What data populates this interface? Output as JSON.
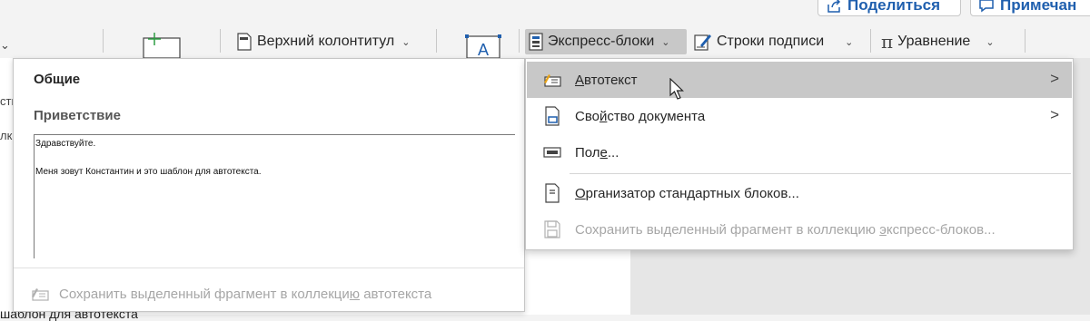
{
  "top_buttons": {
    "share_label": "Поделиться",
    "comments_label": "Примечан"
  },
  "ribbon": {
    "header_footer_label": "Верхний колонтитул",
    "quick_parts_label": "Экспресс-блоки",
    "signature_line_label": "Строки подписи",
    "equation_label": "Уравнение",
    "left_cut_1": "стн",
    "left_cut_2": "лк"
  },
  "autotext_gallery": {
    "category": "Общие",
    "entry_title": "Приветствие",
    "preview_line_1": "Здравствуйте.",
    "preview_line_2": "Меня зовут Константин и это шаблон для автотекста.",
    "save_label_pre": "Сохранить выделенный фрагмент в коллекци",
    "save_label_key": "ю",
    "save_label_post": " автотекста"
  },
  "quick_parts_menu": {
    "items": [
      {
        "key": "А",
        "rest": "втотекст",
        "has_submenu": true,
        "highlighted": true
      },
      {
        "pre": "Сво",
        "key": "й",
        "rest": "ство документа",
        "has_submenu": true
      },
      {
        "pre": "Пол",
        "key": "е",
        "rest": "...",
        "has_submenu": false
      },
      {
        "key": "О",
        "rest": "рганизатор стандартных блоков...",
        "has_submenu": false
      },
      {
        "pre": "Сохранить выделенный фрагмент в коллекцию ",
        "key": "э",
        "rest": "кспресс-блоков...",
        "disabled": true
      }
    ]
  },
  "document": {
    "bottom_text": "шаблон для автотекста"
  },
  "colors": {
    "accent": "#1f5fae",
    "menu_highlight": "#c8c8c8",
    "disabled_text": "#a6a6a6"
  }
}
